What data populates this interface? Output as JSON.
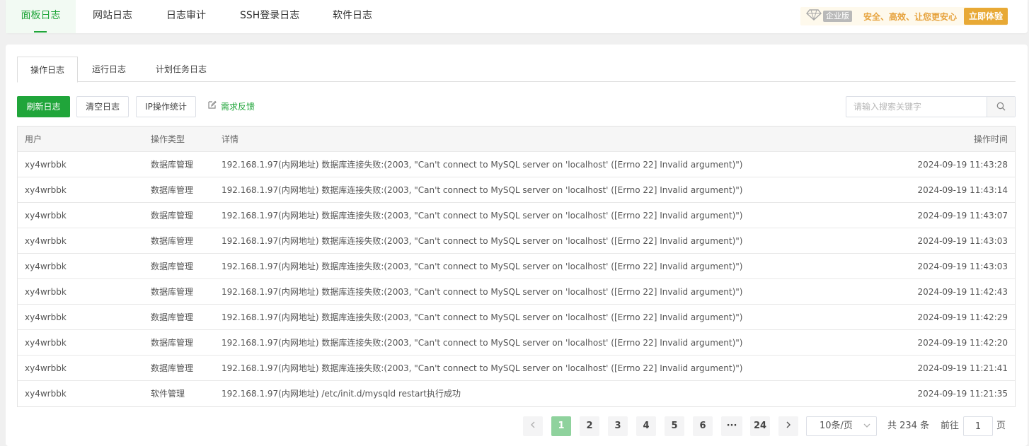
{
  "top_tabs": [
    {
      "label": "面板日志",
      "active": true
    },
    {
      "label": "网站日志",
      "active": false
    },
    {
      "label": "日志审计",
      "active": false
    },
    {
      "label": "SSH登录日志",
      "active": false
    },
    {
      "label": "软件日志",
      "active": false
    }
  ],
  "promo": {
    "badge": "企业版",
    "text": "安全、高效、让您更安心",
    "button": "立即体验"
  },
  "sub_tabs": [
    {
      "label": "操作日志",
      "active": true
    },
    {
      "label": "运行日志",
      "active": false
    },
    {
      "label": "计划任务日志",
      "active": false
    }
  ],
  "toolbar": {
    "refresh": "刷新日志",
    "clear": "清空日志",
    "ip_stats": "IP操作统计",
    "feedback": "需求反馈"
  },
  "search": {
    "placeholder": "请输入搜索关键字",
    "value": ""
  },
  "table": {
    "headers": [
      "用户",
      "操作类型",
      "详情",
      "操作时间"
    ],
    "rows": [
      [
        "xy4wrbbk",
        "数据库管理",
        "192.168.1.97(内网地址) 数据库连接失败:(2003, \"Can't connect to MySQL server on 'localhost' ([Errno 22] Invalid argument)\")",
        "2024-09-19 11:43:28"
      ],
      [
        "xy4wrbbk",
        "数据库管理",
        "192.168.1.97(内网地址) 数据库连接失败:(2003, \"Can't connect to MySQL server on 'localhost' ([Errno 22] Invalid argument)\")",
        "2024-09-19 11:43:14"
      ],
      [
        "xy4wrbbk",
        "数据库管理",
        "192.168.1.97(内网地址) 数据库连接失败:(2003, \"Can't connect to MySQL server on 'localhost' ([Errno 22] Invalid argument)\")",
        "2024-09-19 11:43:07"
      ],
      [
        "xy4wrbbk",
        "数据库管理",
        "192.168.1.97(内网地址) 数据库连接失败:(2003, \"Can't connect to MySQL server on 'localhost' ([Errno 22] Invalid argument)\")",
        "2024-09-19 11:43:03"
      ],
      [
        "xy4wrbbk",
        "数据库管理",
        "192.168.1.97(内网地址) 数据库连接失败:(2003, \"Can't connect to MySQL server on 'localhost' ([Errno 22] Invalid argument)\")",
        "2024-09-19 11:43:03"
      ],
      [
        "xy4wrbbk",
        "数据库管理",
        "192.168.1.97(内网地址) 数据库连接失败:(2003, \"Can't connect to MySQL server on 'localhost' ([Errno 22] Invalid argument)\")",
        "2024-09-19 11:42:43"
      ],
      [
        "xy4wrbbk",
        "数据库管理",
        "192.168.1.97(内网地址) 数据库连接失败:(2003, \"Can't connect to MySQL server on 'localhost' ([Errno 22] Invalid argument)\")",
        "2024-09-19 11:42:29"
      ],
      [
        "xy4wrbbk",
        "数据库管理",
        "192.168.1.97(内网地址) 数据库连接失败:(2003, \"Can't connect to MySQL server on 'localhost' ([Errno 22] Invalid argument)\")",
        "2024-09-19 11:42:20"
      ],
      [
        "xy4wrbbk",
        "数据库管理",
        "192.168.1.97(内网地址) 数据库连接失败:(2003, \"Can't connect to MySQL server on 'localhost' ([Errno 22] Invalid argument)\")",
        "2024-09-19 11:21:41"
      ],
      [
        "xy4wrbbk",
        "软件管理",
        "192.168.1.97(内网地址) /etc/init.d/mysqld restart执行成功",
        "2024-09-19 11:21:35"
      ]
    ]
  },
  "pagination": {
    "pages": [
      "1",
      "2",
      "3",
      "4",
      "5",
      "6",
      "···",
      "24"
    ],
    "current": "1",
    "page_size": "10条/页",
    "total": "共 234 条",
    "goto_label": "前往",
    "goto_value": "1",
    "goto_suffix": "页"
  },
  "colors": {
    "accent": "#20a53a",
    "promo": "#e8a935",
    "active_page": "#8fd29d"
  }
}
